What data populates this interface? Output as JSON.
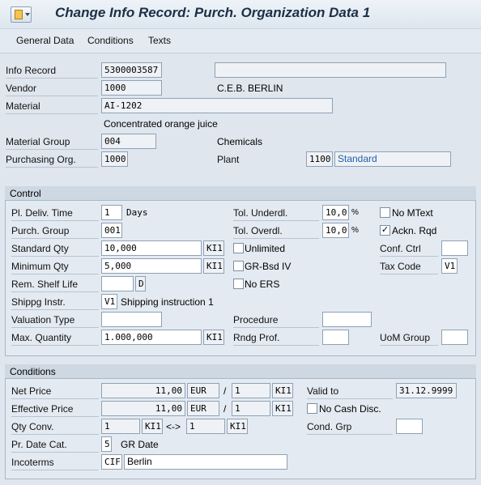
{
  "title": "Change Info Record: Purch. Organization Data 1",
  "menu": [
    "General Data",
    "Conditions",
    "Texts"
  ],
  "header": {
    "info_record_label": "Info Record",
    "info_record_value": "5300003587",
    "info_record_extra": "",
    "vendor_label": "Vendor",
    "vendor_value": "1000",
    "vendor_name": "C.E.B. BERLIN",
    "material_label": "Material",
    "material_value": "AI-1202",
    "material_desc": "Concentrated orange juice",
    "material_group_label": "Material Group",
    "material_group_value": "004",
    "material_group_text": "Chemicals",
    "purch_org_label": "Purchasing Org.",
    "purch_org_value": "1000",
    "plant_label": "Plant",
    "plant_value": "1100",
    "plant_type": "Standard"
  },
  "control": {
    "section_title": "Control",
    "pl_deliv_label": "Pl. Deliv. Time",
    "pl_deliv_value": "1",
    "pl_deliv_unit": "Days",
    "purch_group_label": "Purch. Group",
    "purch_group_value": "001",
    "std_qty_label": "Standard Qty",
    "std_qty_value": "10,000",
    "std_qty_unit": "KI1",
    "min_qty_label": "Minimum Qty",
    "min_qty_value": "5,000",
    "min_qty_unit": "KI1",
    "shelf_life_label": "Rem. Shelf Life",
    "shelf_life_value": "",
    "shelf_life_unit": "D",
    "shipping_label": "Shippg Instr.",
    "shipping_value": "V1",
    "shipping_text": "Shipping instruction 1",
    "valuation_label": "Valuation Type",
    "valuation_value": "",
    "max_qty_label": "Max. Quantity",
    "max_qty_value": "1.000,000",
    "max_qty_unit": "KI1",
    "tol_under_label": "Tol. Underdl.",
    "tol_under_value": "10,0",
    "tol_under_pct": "%",
    "tol_over_label": "Tol. Overdl.",
    "tol_over_value": "10,0",
    "tol_over_pct": "%",
    "unlimited_label": "Unlimited",
    "grbsd_label": "GR-Bsd IV",
    "noers_label": "No ERS",
    "procedure_label": "Procedure",
    "procedure_value": "",
    "rndg_label": "Rndg Prof.",
    "rndg_value": "",
    "nomtext_label": "No MText",
    "acknrqd_label": "Ackn. Rqd",
    "acknrqd_mark": "✓",
    "confctrl_label": "Conf. Ctrl",
    "confctrl_value": "",
    "taxcode_label": "Tax Code",
    "taxcode_value": "V1",
    "uom_label": "UoM Group",
    "uom_value": ""
  },
  "conditions": {
    "section_title": "Conditions",
    "net_label": "Net Price",
    "net_value": "11,00",
    "net_curr": "EUR",
    "net_slash": "/",
    "net_per": "1",
    "net_unit": "KI1",
    "eff_label": "Effective Price",
    "eff_value": "11,00",
    "eff_curr": "EUR",
    "eff_slash": "/",
    "eff_per": "1",
    "eff_unit": "KI1",
    "qty_label": "Qty Conv.",
    "qty_a": "1",
    "qty_unit_a": "KI1",
    "qty_arrow": "<->",
    "qty_b": "1",
    "qty_unit_b": "KI1",
    "prdate_label": "Pr. Date Cat.",
    "prdate_value": "5",
    "prdate_text": "GR Date",
    "inco_label": "Incoterms",
    "inco_value": "CIF",
    "inco_text": "Berlin",
    "valid_label": "Valid to",
    "valid_value": "31.12.9999",
    "nocash_label": "No Cash Disc.",
    "condgrp_label": "Cond. Grp",
    "condgrp_value": ""
  }
}
